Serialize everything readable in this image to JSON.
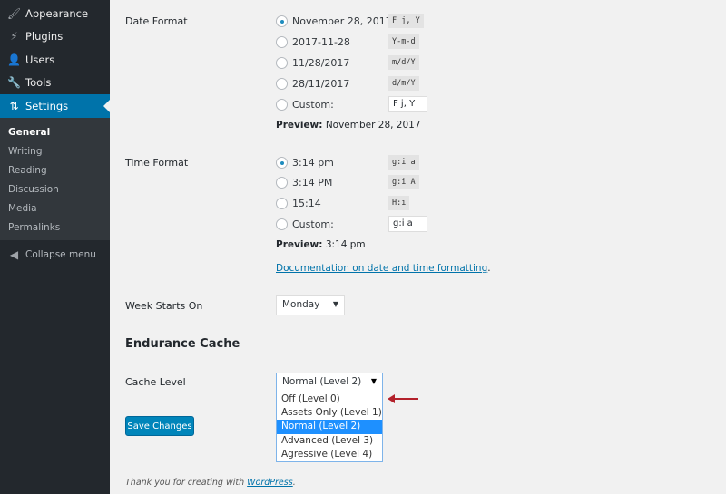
{
  "sidebar": {
    "items": [
      {
        "label": "Appearance",
        "icon": "paintbrush-icon"
      },
      {
        "label": "Plugins",
        "icon": "plug-icon"
      },
      {
        "label": "Users",
        "icon": "user-icon"
      },
      {
        "label": "Tools",
        "icon": "wrench-icon"
      },
      {
        "label": "Settings",
        "icon": "sliders-icon",
        "active": true
      }
    ],
    "submenu": [
      "General",
      "Writing",
      "Reading",
      "Discussion",
      "Media",
      "Permalinks"
    ],
    "collapse": "Collapse menu"
  },
  "date_format": {
    "label": "Date Format",
    "options": [
      {
        "text": "November 28, 2017",
        "code": "F j, Y",
        "checked": true
      },
      {
        "text": "2017-11-28",
        "code": "Y-m-d"
      },
      {
        "text": "11/28/2017",
        "code": "m/d/Y"
      },
      {
        "text": "28/11/2017",
        "code": "d/m/Y"
      },
      {
        "text": "Custom:",
        "value": "F j, Y"
      }
    ],
    "preview_label": "Preview:",
    "preview": "November 28, 2017"
  },
  "time_format": {
    "label": "Time Format",
    "options": [
      {
        "text": "3:14 pm",
        "code": "g:i a",
        "checked": true
      },
      {
        "text": "3:14 PM",
        "code": "g:i A"
      },
      {
        "text": "15:14",
        "code": "H:i"
      },
      {
        "text": "Custom:",
        "value": "g:i a"
      }
    ],
    "preview_label": "Preview:",
    "preview": "3:14 pm",
    "doc_link": "Documentation on date and time formatting",
    "doc_suffix": "."
  },
  "week": {
    "label": "Week Starts On",
    "value": "Monday"
  },
  "cache": {
    "heading": "Endurance Cache",
    "label": "Cache Level",
    "value": "Normal (Level 2)",
    "options": [
      "Off (Level 0)",
      "Assets Only (Level 1)",
      "Normal (Level 2)",
      "Advanced (Level 3)",
      "Agressive (Level 4)"
    ],
    "selected_index": 2
  },
  "save": "Save Changes",
  "footer": {
    "text": "Thank you for creating with ",
    "link": "WordPress",
    "suffix": "."
  },
  "colors": {
    "accent": "#0073aa",
    "annotation_arrow": "#b3212b"
  }
}
